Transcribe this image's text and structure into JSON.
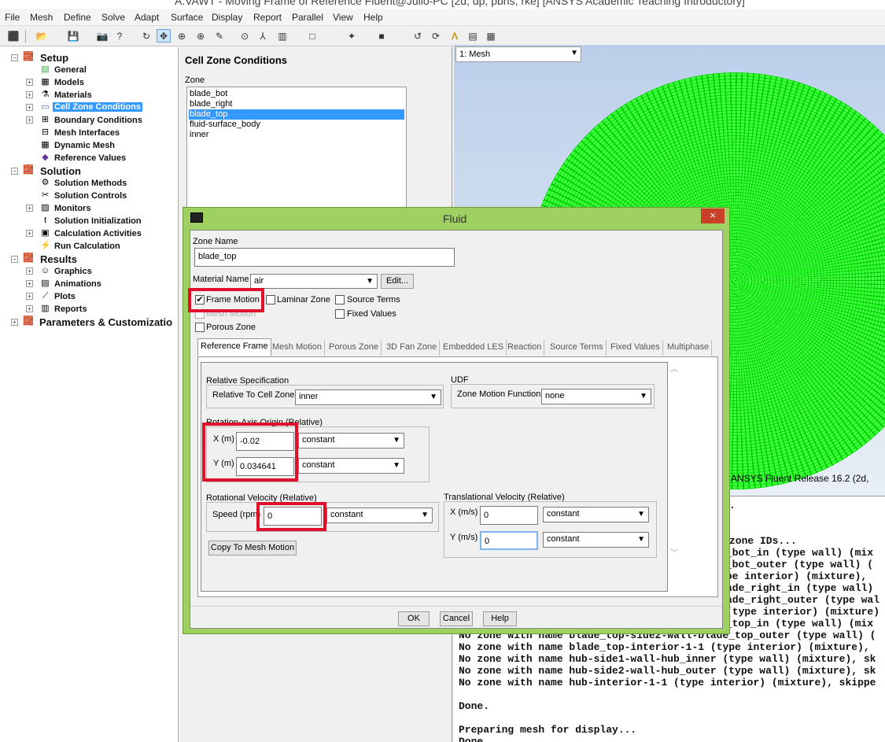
{
  "window": {
    "title": "A.VAWT - Moving Frame of Reference Fluent@Julio-PC [2d, dp, pbns, rke] [ANSYS Academic Teaching Introductory]"
  },
  "menu": [
    "File",
    "Mesh",
    "Define",
    "Solve",
    "Adapt",
    "Surface",
    "Display",
    "Report",
    "Parallel",
    "View",
    "Help"
  ],
  "tree": {
    "setup": "Setup",
    "general": "General",
    "models": "Models",
    "materials": "Materials",
    "cell_zone_conditions": "Cell Zone Conditions",
    "boundary_conditions": "Boundary Conditions",
    "mesh_interfaces": "Mesh Interfaces",
    "dynamic_mesh": "Dynamic Mesh",
    "reference_values": "Reference Values",
    "solution": "Solution",
    "solution_methods": "Solution Methods",
    "solution_controls": "Solution Controls",
    "monitors": "Monitors",
    "solution_initialization": "Solution Initialization",
    "calculation_activities": "Calculation Activities",
    "run_calculation": "Run Calculation",
    "results": "Results",
    "graphics": "Graphics",
    "animations": "Animations",
    "plots": "Plots",
    "reports": "Reports",
    "parameters": "Parameters & Customizatio"
  },
  "cell_zone": {
    "title": "Cell Zone Conditions",
    "zone_label": "Zone",
    "zones": [
      "blade_bot",
      "blade_right",
      "blade_top",
      "fluid-surface_body",
      "inner"
    ]
  },
  "viewport": {
    "selector": "1: Mesh",
    "label": "ANSYS Fluent Release 16.2 (2d,",
    "accent": "#00e000"
  },
  "console": {
    "lines": [
      ".",
      "",
      "zone IDs...",
      "e_bot_in (type wall) (mix",
      "e_bot_outer (type wall) (",
      "ype interior) (mixture),",
      "ade_right_in (type wall)",
      "ade_right_outer (type wal",
      "(type interior) (mixture)",
      "e_top_in (type wall) (mix",
      "No zone with name blade_top-side2-wall-blade_top_outer (type wall) (",
      "No zone with name blade_top-interior-1-1 (type interior) (mixture),",
      "No zone with name hub-side1-wall-hub_inner (type wall) (mixture), sk",
      "No zone with name hub-side2-wall-hub_outer (type wall) (mixture), sk",
      "No zone with name hub-interior-1-1 (type interior) (mixture), skippe",
      "",
      "Done.",
      "",
      "Preparing mesh for display...",
      "Done."
    ]
  },
  "dialog": {
    "title": "Fluid",
    "close": "×",
    "zone_name_label": "Zone Name",
    "zone_name": "blade_top",
    "material_label": "Material Name",
    "material": "air",
    "edit": "Edit...",
    "frame_motion": "Frame Motion",
    "laminar_zone": "Laminar Zone",
    "source_terms": "Source Terms",
    "mesh_motion": "Mesh Motion",
    "fixed_values": "Fixed Values",
    "porous_zone": "Porous Zone",
    "tabs": [
      "Reference Frame",
      "Mesh Motion",
      "Porous Zone",
      "3D Fan Zone",
      "Embedded LES",
      "Reaction",
      "Source Terms",
      "Fixed Values",
      "Multiphase"
    ],
    "relative_spec": "Relative Specification",
    "relative_to": "Relative To Cell Zone",
    "relative_to_value": "inner",
    "udf": "UDF",
    "zone_motion_fn": "Zone Motion Function",
    "zone_motion_value": "none",
    "axis_origin": "Rotation-Axis Origin (Relative)",
    "x_label": "X (m)",
    "x_value": "-0.02",
    "y_label": "Y (m)",
    "y_value": "0.034641",
    "constant": "constant",
    "rot_vel": "Rotational Velocity (Relative)",
    "speed_label": "Speed (rpm)",
    "speed_value": "0",
    "trans_vel": "Translational Velocity (Relative)",
    "xms": "X (m/s)",
    "xms_value": "0",
    "yms": "Y (m/s)",
    "yms_value": "0",
    "copy": "Copy To Mesh Motion",
    "ok": "OK",
    "cancel": "Cancel",
    "help": "Help",
    "highlight": "#e0102a"
  }
}
